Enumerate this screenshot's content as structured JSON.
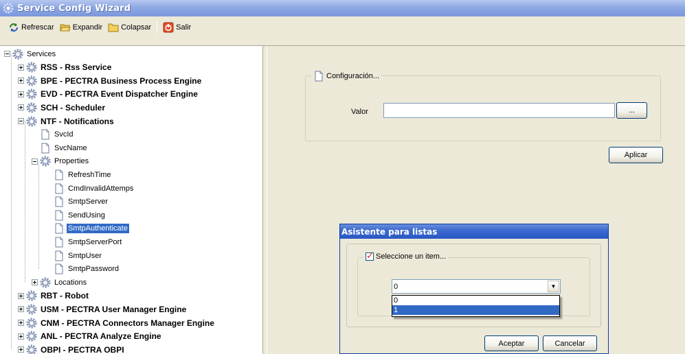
{
  "window": {
    "title": "Service Config Wizard"
  },
  "toolbar": {
    "items": [
      {
        "label": "Refrescar",
        "icon": "refresh-icon"
      },
      {
        "label": "Expandir",
        "icon": "folder-open-icon"
      },
      {
        "label": "Colapsar",
        "icon": "folder-icon"
      },
      {
        "label": "Salir",
        "icon": "exit-icon"
      }
    ]
  },
  "tree": {
    "nodes": [
      {
        "label": "Services",
        "level": 0,
        "type": "gear",
        "expander": "minus",
        "bold": false
      },
      {
        "label": "RSS - Rss Service",
        "level": 1,
        "type": "gear",
        "expander": "plus",
        "bold": true
      },
      {
        "label": "BPE - PECTRA Business Process Engine",
        "level": 1,
        "type": "gear",
        "expander": "plus",
        "bold": true
      },
      {
        "label": "EVD - PECTRA Event Dispatcher Engine",
        "level": 1,
        "type": "gear",
        "expander": "plus",
        "bold": true
      },
      {
        "label": "SCH - Scheduler",
        "level": 1,
        "type": "gear",
        "expander": "plus",
        "bold": true
      },
      {
        "label": "NTF - Notifications",
        "level": 1,
        "type": "gear",
        "expander": "minus",
        "bold": true
      },
      {
        "label": "SvcId",
        "level": 2,
        "type": "doc",
        "expander": "none",
        "bold": false
      },
      {
        "label": "SvcName",
        "level": 2,
        "type": "doc",
        "expander": "none",
        "bold": false
      },
      {
        "label": "Properties",
        "level": 2,
        "type": "gear",
        "expander": "minus",
        "bold": false
      },
      {
        "label": "RefreshTime",
        "level": 3,
        "type": "doc",
        "expander": "none",
        "bold": false
      },
      {
        "label": "CmdInvalidAttemps",
        "level": 3,
        "type": "doc",
        "expander": "none",
        "bold": false
      },
      {
        "label": "SmtpServer",
        "level": 3,
        "type": "doc",
        "expander": "none",
        "bold": false
      },
      {
        "label": "SendUsing",
        "level": 3,
        "type": "doc",
        "expander": "none",
        "bold": false
      },
      {
        "label": "SmtpAuthenticate",
        "level": 3,
        "type": "doc",
        "expander": "none",
        "bold": false,
        "selected": true
      },
      {
        "label": "SmtpServerPort",
        "level": 3,
        "type": "doc",
        "expander": "none",
        "bold": false
      },
      {
        "label": "SmtpUser",
        "level": 3,
        "type": "doc",
        "expander": "none",
        "bold": false
      },
      {
        "label": "SmtpPassword",
        "level": 3,
        "type": "doc",
        "expander": "none",
        "bold": false
      },
      {
        "label": "Locations",
        "level": 2,
        "type": "gear",
        "expander": "plus",
        "bold": false
      },
      {
        "label": "RBT - Robot",
        "level": 1,
        "type": "gear",
        "expander": "plus",
        "bold": true
      },
      {
        "label": "USM - PECTRA User Manager Engine",
        "level": 1,
        "type": "gear",
        "expander": "plus",
        "bold": true
      },
      {
        "label": "CNM - PECTRA Connectors Manager Engine",
        "level": 1,
        "type": "gear",
        "expander": "plus",
        "bold": true
      },
      {
        "label": "ANL - PECTRA Analyze Engine",
        "level": 1,
        "type": "gear",
        "expander": "plus",
        "bold": true
      },
      {
        "label": "OBPI - PECTRA OBPI",
        "level": 1,
        "type": "gear",
        "expander": "plus",
        "bold": true
      }
    ]
  },
  "config": {
    "group_title": "Configuración...",
    "value_label": "Valor",
    "value": "",
    "browse_label": "...",
    "apply_label": "Aplicar"
  },
  "list_dialog": {
    "title": "Asistente para listas",
    "group_title": "Seleccione un item...",
    "combo_value": "0",
    "options": [
      "0",
      "1"
    ],
    "selected_option": "1",
    "ok_label": "Aceptar",
    "cancel_label": "Cancelar"
  }
}
